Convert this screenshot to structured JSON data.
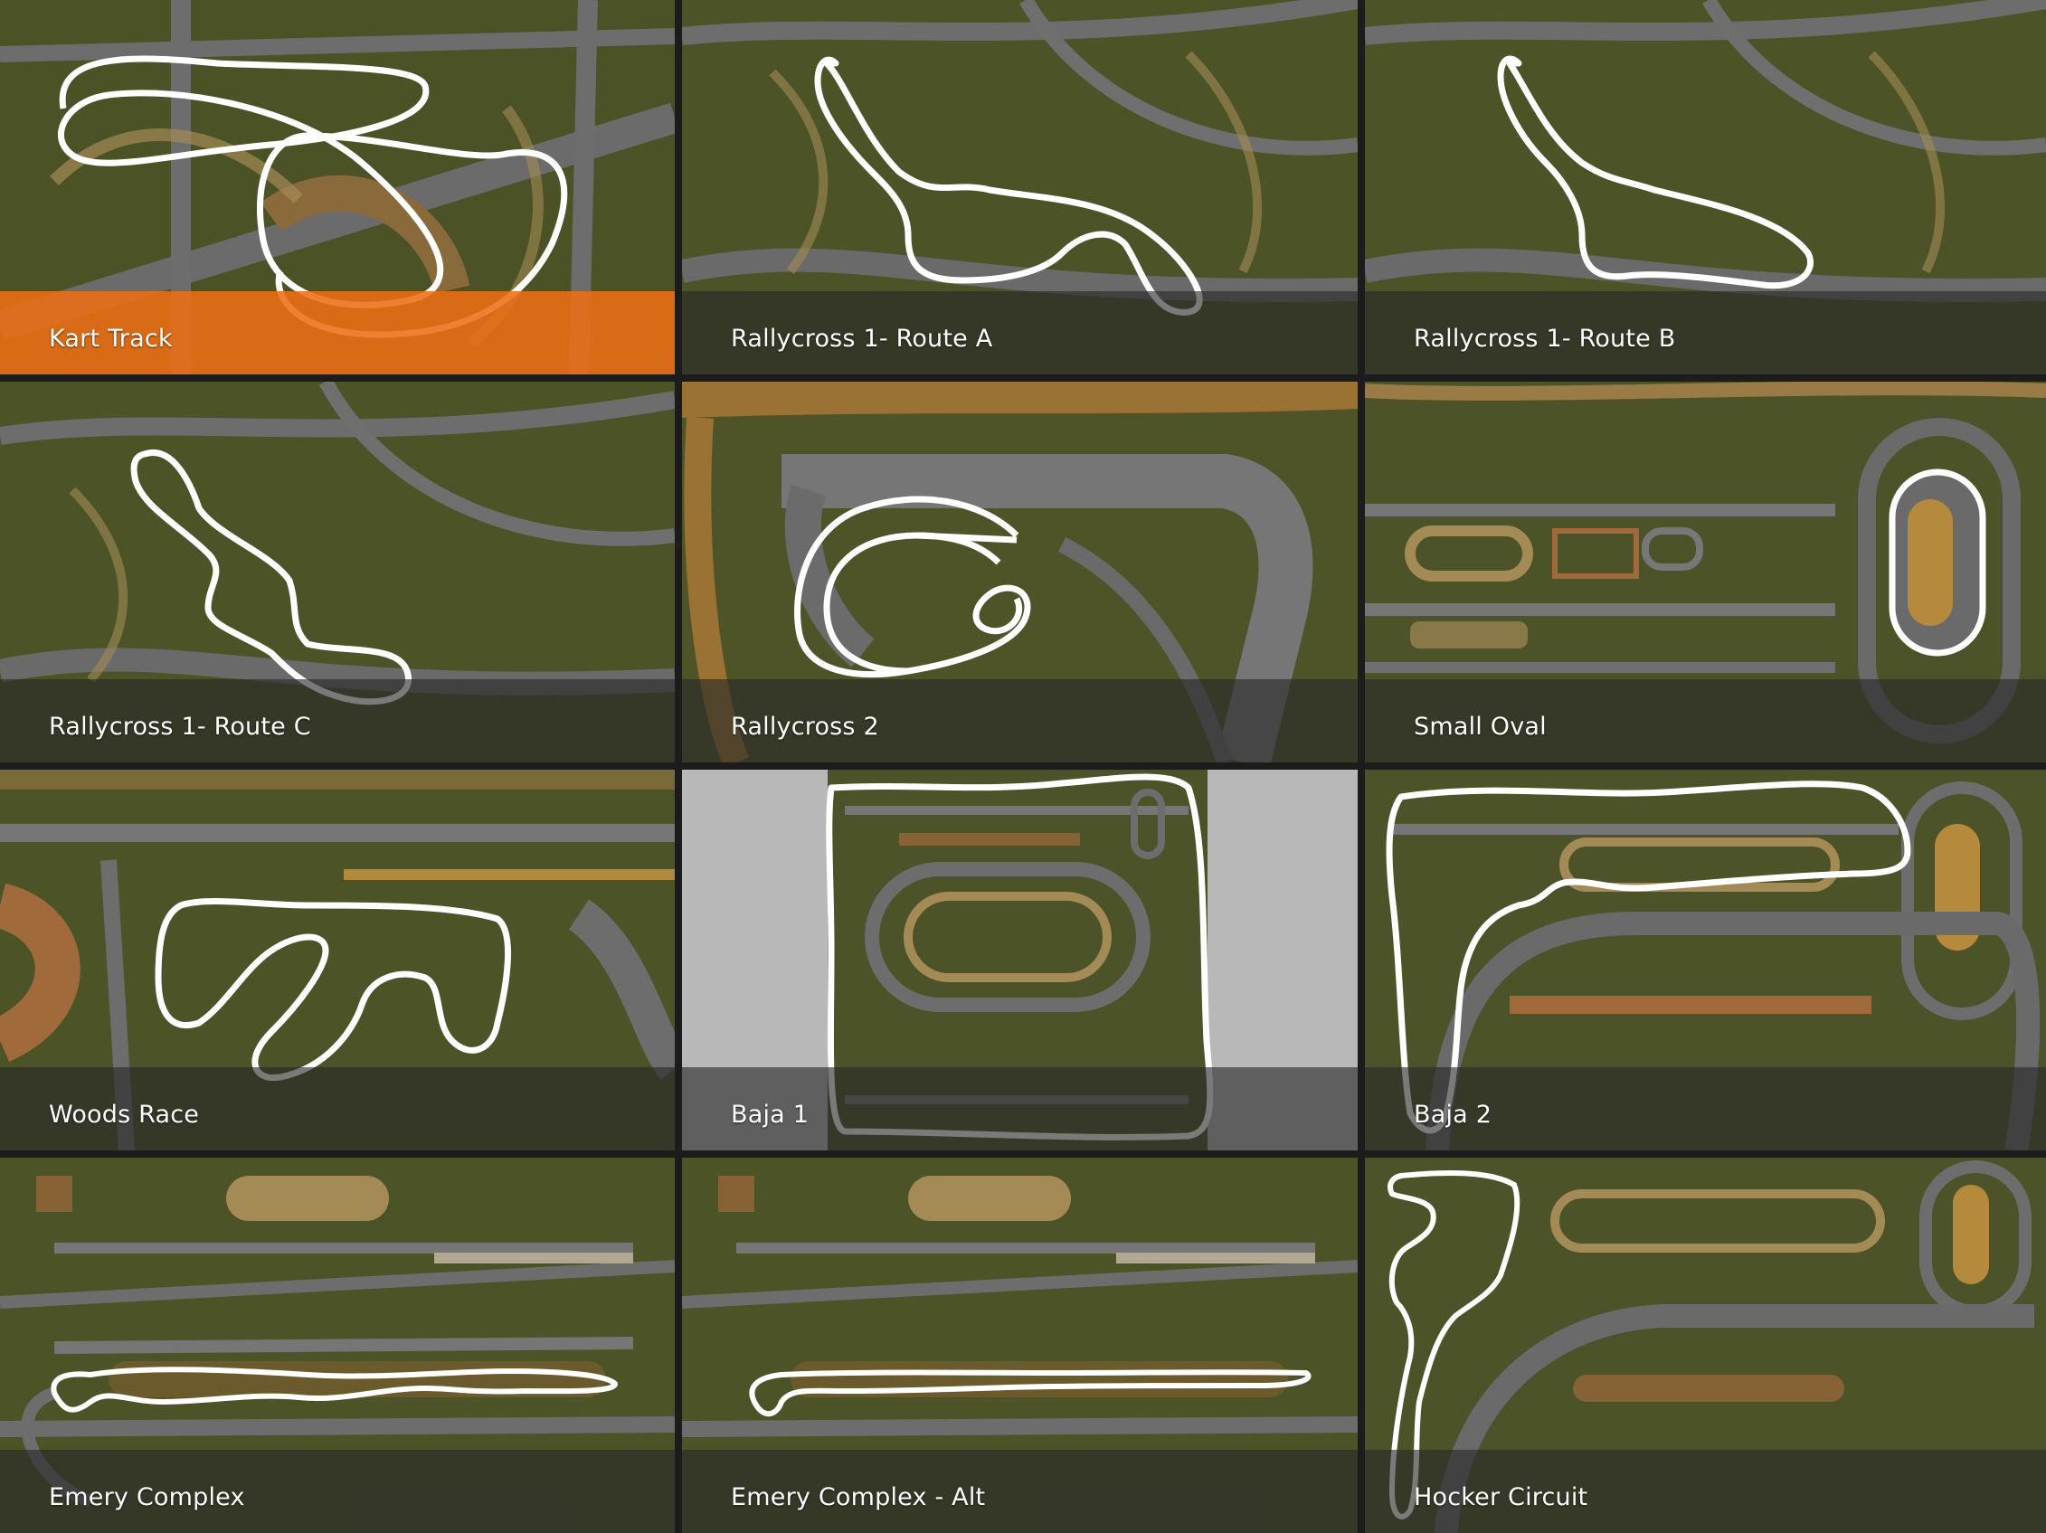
{
  "selected_index": 0,
  "accent_color": "#ee6e14",
  "tracks": [
    {
      "label": "Kart Track",
      "map_icon": "kart-track-map"
    },
    {
      "label": "Rallycross 1- Route A",
      "map_icon": "rallycross-1-route-a-map"
    },
    {
      "label": "Rallycross 1- Route B",
      "map_icon": "rallycross-1-route-b-map"
    },
    {
      "label": "Rallycross 1- Route C",
      "map_icon": "rallycross-1-route-c-map"
    },
    {
      "label": "Rallycross 2",
      "map_icon": "rallycross-2-map"
    },
    {
      "label": "Small Oval",
      "map_icon": "small-oval-map"
    },
    {
      "label": "Woods Race",
      "map_icon": "woods-race-map"
    },
    {
      "label": "Baja 1",
      "map_icon": "baja-1-map"
    },
    {
      "label": "Baja 2",
      "map_icon": "baja-2-map"
    },
    {
      "label": "Emery Complex",
      "map_icon": "emery-complex-map"
    },
    {
      "label": "Emery Complex - Alt",
      "map_icon": "emery-complex-alt-map"
    },
    {
      "label": "Hocker Circuit",
      "map_icon": "hocker-circuit-map"
    }
  ]
}
